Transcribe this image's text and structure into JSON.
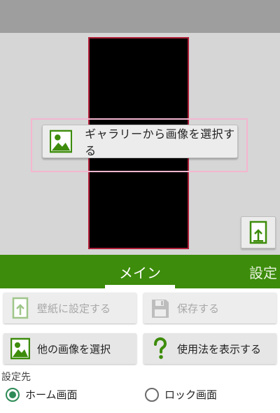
{
  "preview": {
    "gallery_button_label": "ギャラリーから画像を選択する",
    "set_wallpaper_icon": "phone-set-icon",
    "gallery_icon": "image-icon"
  },
  "tabs": [
    {
      "label": "メイン",
      "active": true
    },
    {
      "label": "設定",
      "active": false
    }
  ],
  "actions": {
    "set_wallpaper": {
      "label": "壁紙に設定する",
      "enabled": false,
      "icon": "phone-set-icon"
    },
    "save": {
      "label": "保存する",
      "enabled": false,
      "icon": "floppy-icon"
    },
    "select_other": {
      "label": "他の画像を選択",
      "enabled": true,
      "icon": "image-icon"
    },
    "help": {
      "label": "使用法を表示する",
      "enabled": true,
      "icon": "question-icon"
    }
  },
  "target": {
    "label": "設定先",
    "options": [
      {
        "label": "ホーム画面",
        "checked": true
      },
      {
        "label": "ロック画面",
        "checked": false
      }
    ]
  },
  "colors": {
    "accent": "#3d8c0c",
    "radio_checked": "#2e8b57",
    "frame_border": "#b0203a",
    "highlight": "#f4b6cf"
  }
}
